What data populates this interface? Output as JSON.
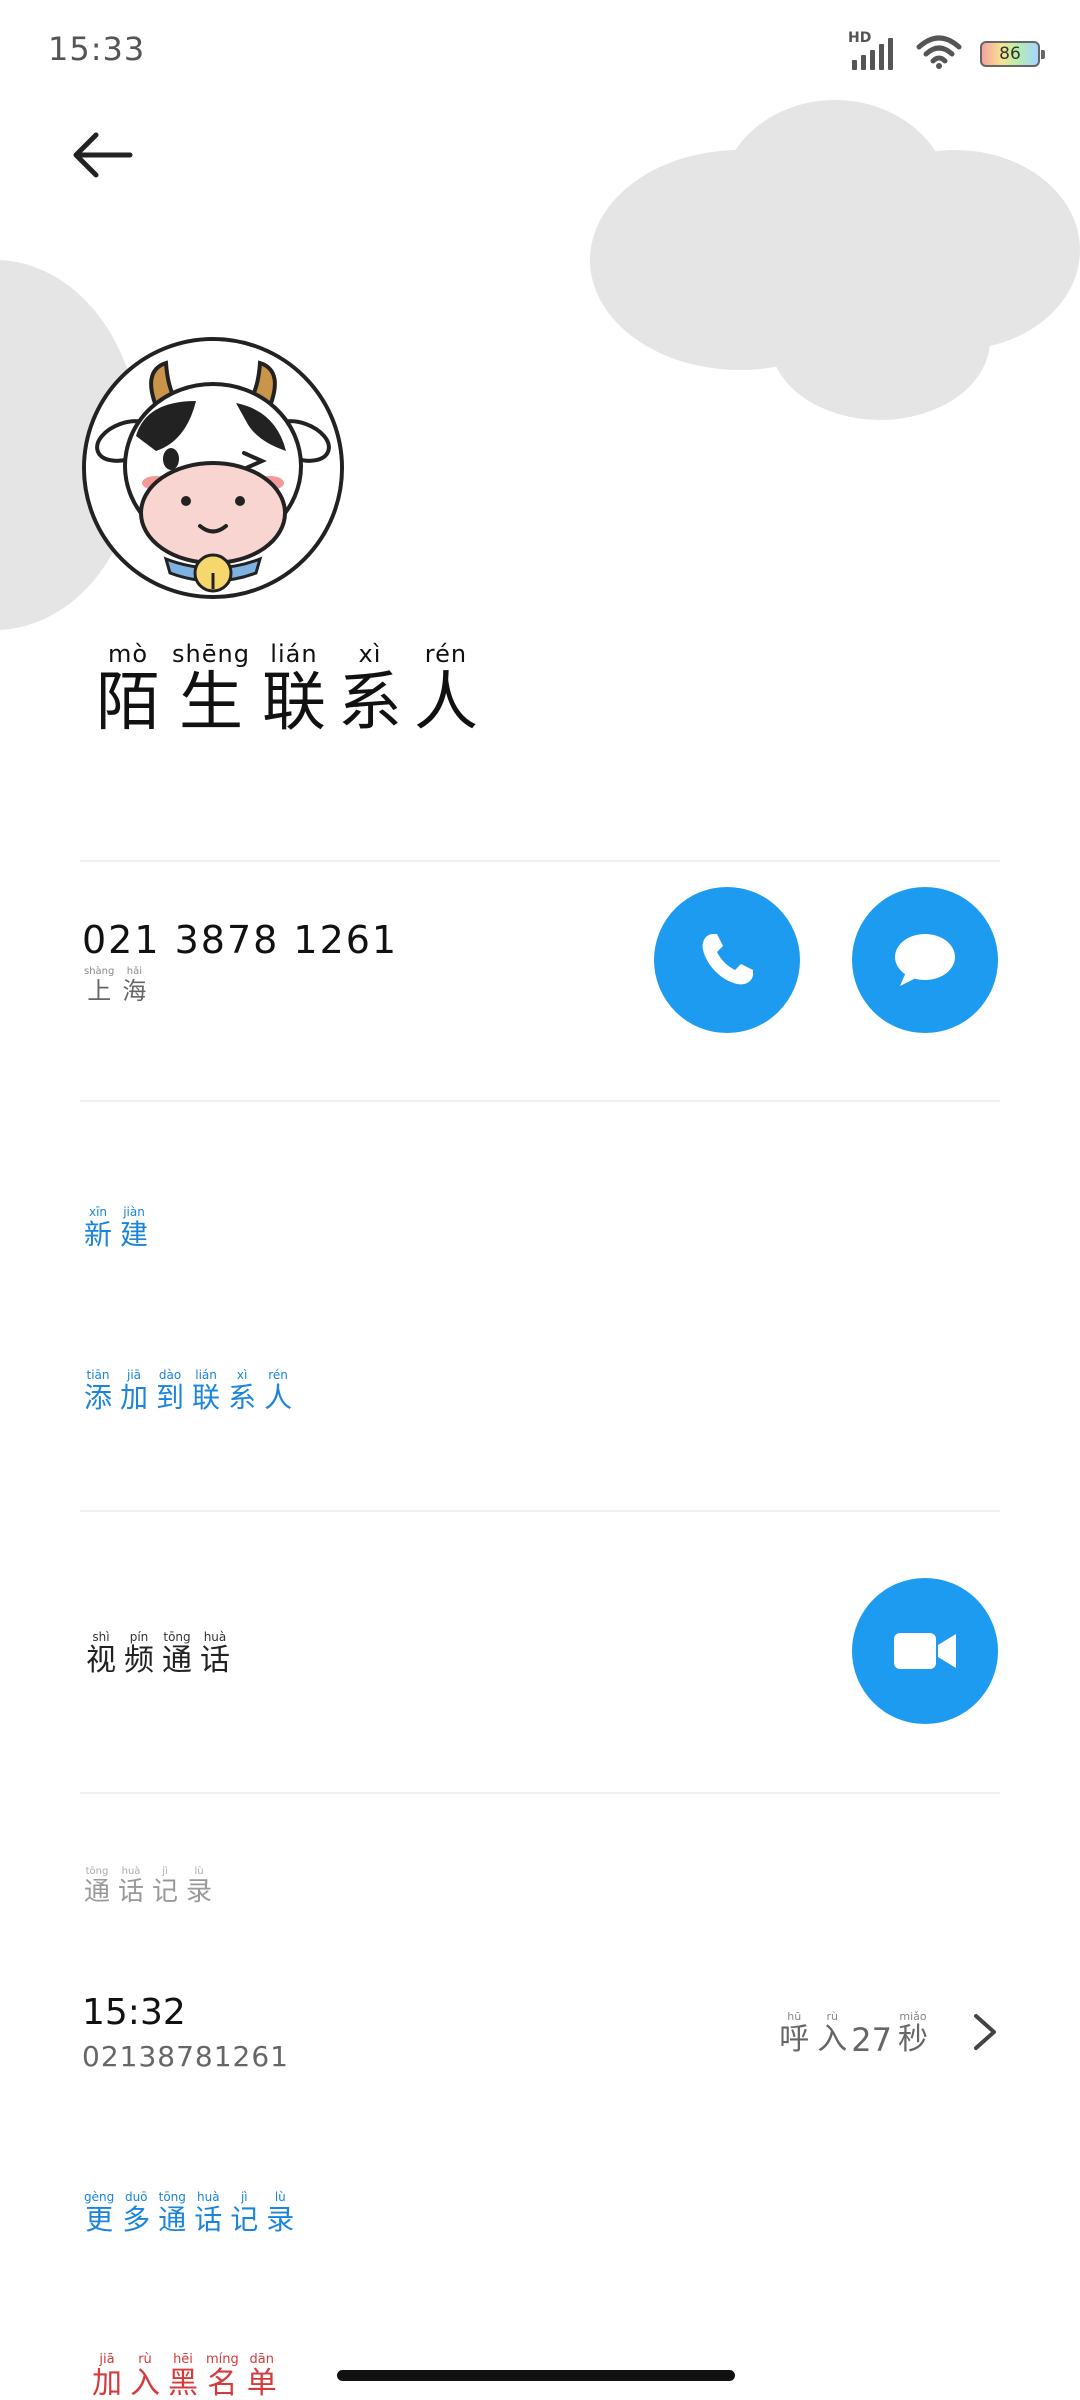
{
  "status_bar": {
    "time": "15:33",
    "network_label": "HD",
    "battery_level": "86",
    "icons": [
      "signal-icon",
      "wifi-icon",
      "battery-icon"
    ]
  },
  "header": {
    "back_icon": "back-arrow-icon"
  },
  "contact": {
    "name": [
      {
        "py": "mò",
        "hz": "陌"
      },
      {
        "py": "shēng",
        "hz": "生"
      },
      {
        "py": "lián",
        "hz": "联"
      },
      {
        "py": "xì",
        "hz": "系"
      },
      {
        "py": "rén",
        "hz": "人"
      }
    ],
    "avatar_icon": "cartoon-cow-avatar"
  },
  "phone": {
    "number": "021 3878 1261",
    "location": [
      {
        "py": "shàng",
        "hz": "上"
      },
      {
        "py": "hǎi",
        "hz": "海"
      }
    ],
    "call_icon": "phone-icon",
    "message_icon": "message-icon"
  },
  "actions": {
    "new": [
      {
        "py": "xīn",
        "hz": "新"
      },
      {
        "py": "jiàn",
        "hz": "建"
      }
    ],
    "add_to_contact": [
      {
        "py": "tiān",
        "hz": "添"
      },
      {
        "py": "jiā",
        "hz": "加"
      },
      {
        "py": "dào",
        "hz": "到"
      },
      {
        "py": "lián",
        "hz": "联"
      },
      {
        "py": "xì",
        "hz": "系"
      },
      {
        "py": "rén",
        "hz": "人"
      }
    ],
    "video_call": [
      {
        "py": "shì",
        "hz": "视"
      },
      {
        "py": "pín",
        "hz": "频"
      },
      {
        "py": "tōng",
        "hz": "通"
      },
      {
        "py": "huà",
        "hz": "话"
      }
    ],
    "video_icon": "video-camera-icon"
  },
  "call_log": {
    "section_title": [
      {
        "py": "tōng",
        "hz": "通"
      },
      {
        "py": "huà",
        "hz": "话"
      },
      {
        "py": "jì",
        "hz": "记"
      },
      {
        "py": "lù",
        "hz": "录"
      }
    ],
    "entry": {
      "time": "15:32",
      "number": "02138781261",
      "type": [
        {
          "py": "hū",
          "hz": "呼"
        },
        {
          "py": "rù",
          "hz": "入"
        }
      ],
      "duration_value": "27",
      "duration_unit": [
        {
          "py": "miǎo",
          "hz": "秒"
        }
      ]
    },
    "more": [
      {
        "py": "gèng",
        "hz": "更"
      },
      {
        "py": "duō",
        "hz": "多"
      },
      {
        "py": "tōng",
        "hz": "通"
      },
      {
        "py": "huà",
        "hz": "话"
      },
      {
        "py": "jì",
        "hz": "记"
      },
      {
        "py": "lù",
        "hz": "录"
      }
    ]
  },
  "blacklist": [
    {
      "py": "jiā",
      "hz": "加"
    },
    {
      "py": "rù",
      "hz": "入"
    },
    {
      "py": "hēi",
      "hz": "黑"
    },
    {
      "py": "míng",
      "hz": "名"
    },
    {
      "py": "dān",
      "hz": "单"
    }
  ],
  "colors": {
    "accent": "#1d9bf0",
    "link": "#1a84de",
    "danger": "#d63a3a"
  }
}
